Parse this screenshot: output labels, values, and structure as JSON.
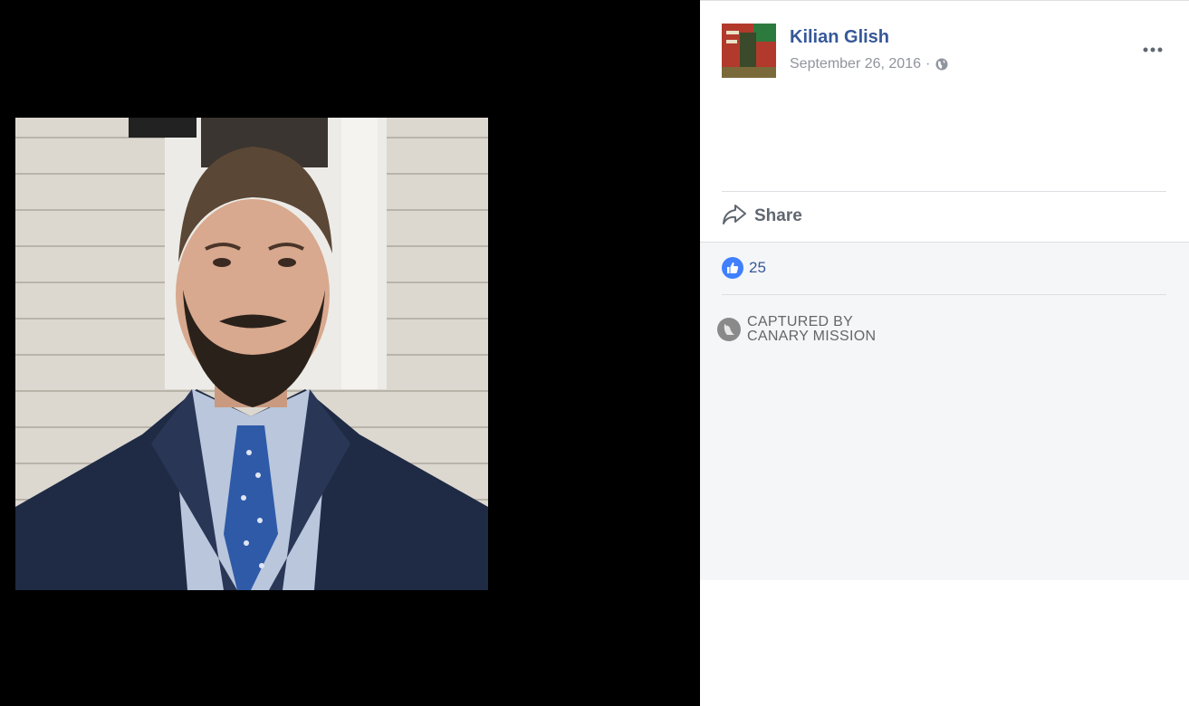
{
  "post": {
    "author": "Kilian Glish",
    "date": "September 26, 2016",
    "separator": "·",
    "privacy_icon": "globe-icon",
    "more_icon": "ellipsis-icon"
  },
  "actions": {
    "share_label": "Share",
    "share_icon": "share-arrow-icon"
  },
  "reactions": {
    "icon": "thumbs-up-icon",
    "count": "25"
  },
  "watermark": {
    "line1": "CAPTURED BY",
    "line2": "CANARY MISSION"
  },
  "colors": {
    "link": "#365899",
    "like": "#4080ff",
    "muted": "#90949c",
    "viewer_bg": "#000000"
  }
}
